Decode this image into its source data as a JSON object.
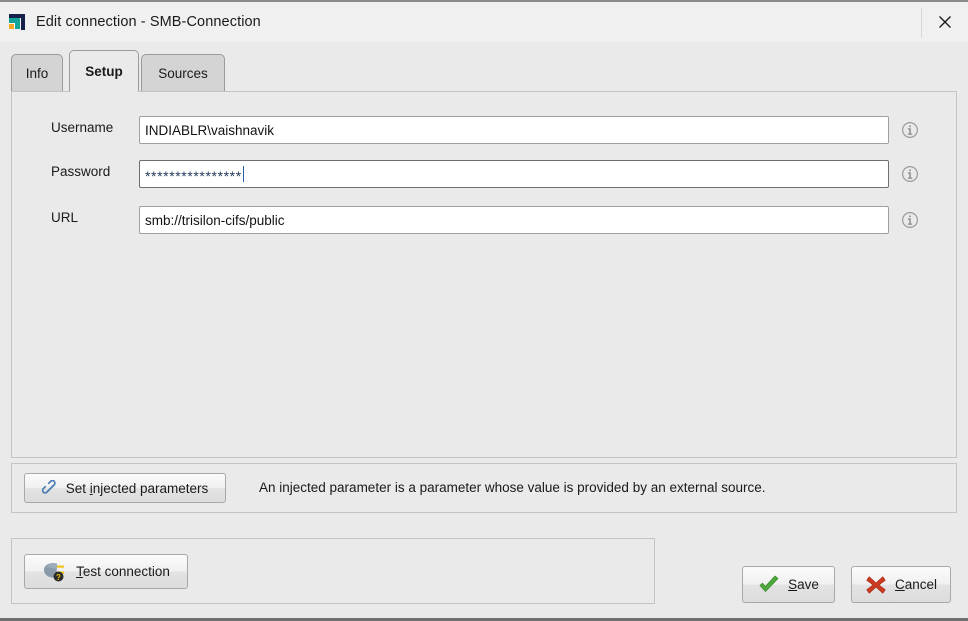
{
  "window": {
    "title": "Edit connection - SMB-Connection",
    "app_icon": "app-logo-icon",
    "close_label": "×"
  },
  "tabs": [
    {
      "label": "Info",
      "active": false
    },
    {
      "label": "Setup",
      "active": true
    },
    {
      "label": "Sources",
      "active": false
    }
  ],
  "form": {
    "username": {
      "label": "Username",
      "value": "INDIABLR\\vaishnavik",
      "info_icon": "info-icon"
    },
    "password": {
      "label": "Password",
      "value": "****************",
      "masked_char_count": 16,
      "focused": true,
      "info_icon": "info-icon"
    },
    "url": {
      "label": "URL",
      "value": "smb://trisilon-cifs/public",
      "info_icon": "info-icon"
    }
  },
  "injected": {
    "button_prefix": "Set ",
    "button_mnemonic": "i",
    "button_suffix": "njected parameters",
    "button_label": "Set injected parameters",
    "icon": "chain-link-icon",
    "note": "An injected parameter is a parameter whose value is provided by an external source."
  },
  "test": {
    "button_prefix": "",
    "button_mnemonic": "T",
    "button_suffix": "est connection",
    "button_label": "Test connection",
    "icon": "plug-question-icon"
  },
  "actions": {
    "save": {
      "mnemonic": "S",
      "suffix": "ave",
      "label": "Save",
      "icon": "green-check-icon"
    },
    "cancel": {
      "mnemonic": "C",
      "suffix": "ancel",
      "label": "Cancel",
      "icon": "red-cross-icon"
    }
  },
  "colors": {
    "window_bg": "#eaeaea",
    "titlebar_bg": "#f0f0f0",
    "tab_inactive": "#d4d4d4",
    "panel_border": "#c4c4c4",
    "save_green": "#4faa3c",
    "cancel_red": "#cc3a22",
    "link_blue": "#4a7eb5",
    "logo_navy": "#16204a",
    "logo_teal": "#12a39a",
    "logo_orange": "#f5a623"
  }
}
